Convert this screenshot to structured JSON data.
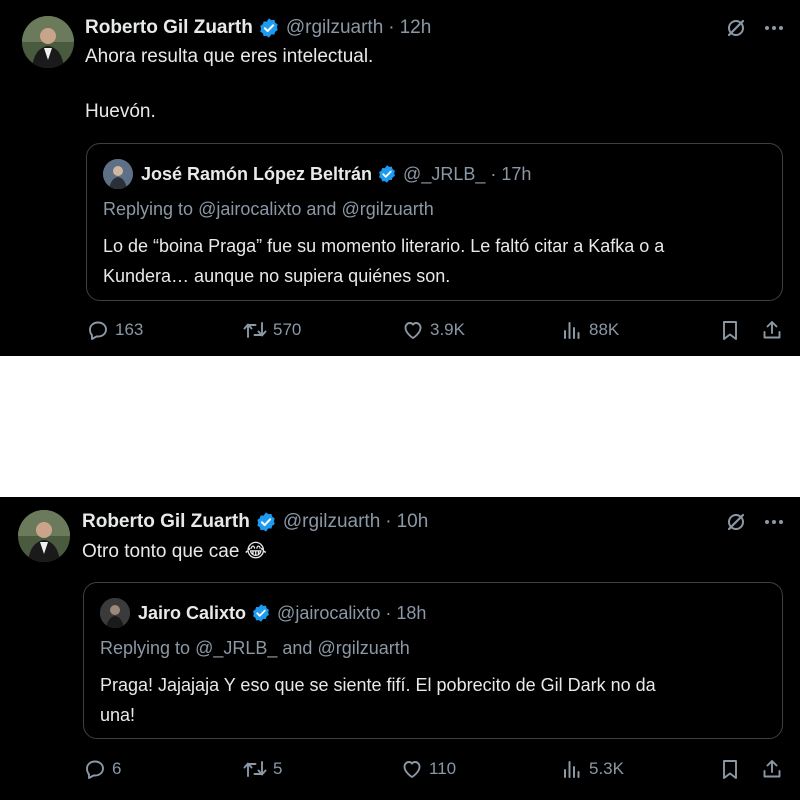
{
  "tweets": [
    {
      "author": {
        "name": "Roberto Gil Zuarth",
        "handle": "@rgilzuarth"
      },
      "time": "12h",
      "text_lines": [
        "Ahora resulta que eres intelectual.",
        "Huevón."
      ],
      "quote": {
        "author": {
          "name": "José Ramón López Beltrán",
          "handle": "@_JRLB_"
        },
        "time": "17h",
        "reply_prefix": "Replying to",
        "reply_to": [
          "@jairocalixto",
          "@rgilzuarth"
        ],
        "reply_joiner": "and",
        "text_lines": [
          "Lo de “boina Praga” fue su momento literario. Le faltó citar a Kafka o a",
          "Kundera… aunque no supiera quiénes son."
        ]
      },
      "actions": {
        "replies": "163",
        "reposts": "570",
        "likes": "3.9K",
        "views": "88K"
      }
    },
    {
      "author": {
        "name": "Roberto Gil Zuarth",
        "handle": "@rgilzuarth"
      },
      "time": "10h",
      "text_lines": [
        "Otro tonto que cae 😂"
      ],
      "quote": {
        "author": {
          "name": "Jairo Calixto",
          "handle": "@jairocalixto"
        },
        "time": "18h",
        "reply_prefix": "Replying to",
        "reply_to": [
          "@_JRLB_",
          "@rgilzuarth"
        ],
        "reply_joiner": "and",
        "text_lines": [
          "Praga! Jajajaja Y eso que se siente fifí. El pobrecito de Gil Dark no da",
          "una!"
        ]
      },
      "actions": {
        "replies": "6",
        "reposts": "5",
        "likes": "110",
        "views": "5.3K"
      }
    }
  ],
  "icons": {
    "verified": "verified-badge-icon",
    "grok": "grok-icon",
    "more": "more-icon",
    "reply": "reply-icon",
    "repost": "repost-icon",
    "like": "like-icon",
    "views": "views-icon",
    "bookmark": "bookmark-icon",
    "share": "share-icon"
  },
  "colors": {
    "background": "#000000",
    "text": "#e7e9ea",
    "muted": "#8b98a5",
    "verified": "#1d9bf0",
    "border": "#3a4046"
  }
}
